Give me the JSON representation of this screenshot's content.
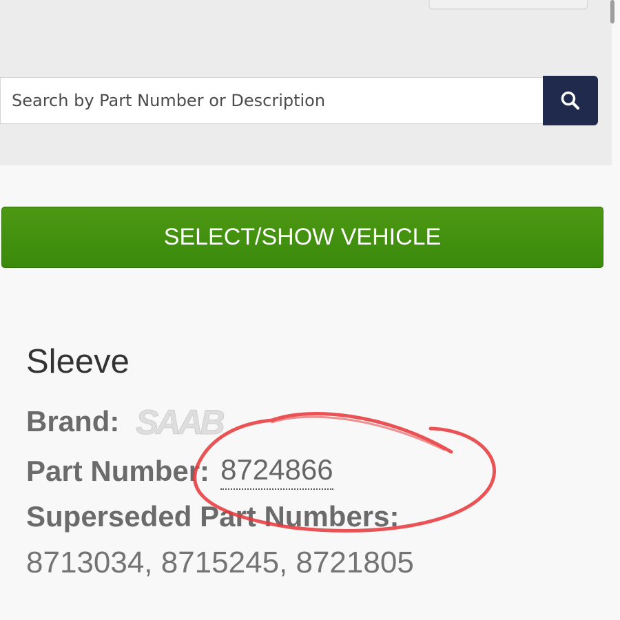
{
  "search": {
    "placeholder": "Search by Part Number or Description",
    "button_icon": "search-icon",
    "button_color": "#1f2a4c"
  },
  "vehicle": {
    "select_label": "SELECT/SHOW VEHICLE",
    "button_color": "#3f8d0e"
  },
  "part": {
    "title": "Sleeve",
    "brand_label": "Brand:",
    "brand_logo": "SAAB",
    "part_number_label": "Part Number:",
    "part_number_value": "8724866",
    "superseded_label": "Superseded Part Numbers:",
    "superseded_values": "8713034, 8715245, 8721805"
  },
  "annotation": {
    "type": "hand-drawn-circle",
    "color": "#e8383a"
  }
}
